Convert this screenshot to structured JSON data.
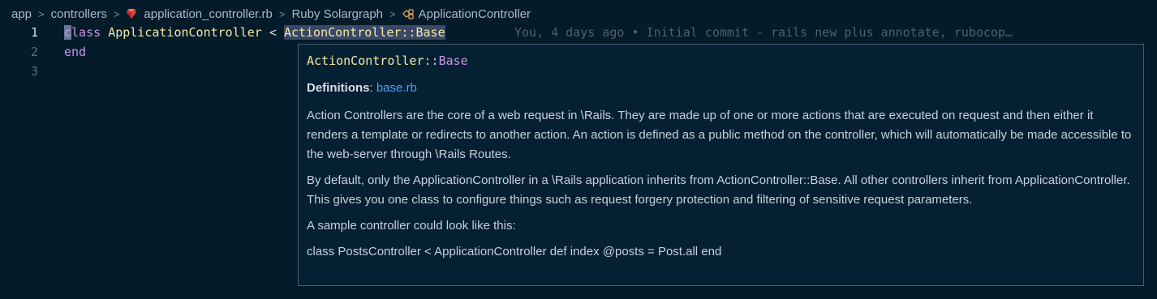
{
  "breadcrumb": {
    "items": [
      "app",
      "controllers",
      "application_controller.rb",
      "Ruby Solargraph",
      "ApplicationController"
    ],
    "separator": ">"
  },
  "editor": {
    "line_numbers": [
      "1",
      "2",
      "3"
    ],
    "line1": {
      "kw_c": "c",
      "kw_rest": "lass",
      "class_name": "ApplicationController",
      "op": "<",
      "parent": "ActionController::Base"
    },
    "line2": {
      "kw": "end"
    },
    "blame": "You, 4 days ago • Initial commit - rails new plus annotate, rubocop…"
  },
  "hover": {
    "signature": {
      "cls": "ActionController",
      "sep": "::",
      "base": "Base"
    },
    "definitions_label": "Definitions",
    "definitions_colon": ":",
    "definitions_link": "base.rb",
    "paragraphs": [
      "Action Controllers are the core of a web request in \\Rails. They are made up of one or more actions that are executed on request and then either it renders a template or redirects to another action. An action is defined as a public method on the controller, which will automatically be made accessible to the web-server through \\Rails Routes.",
      "By default, only the ApplicationController in a \\Rails application inherits from ActionController::Base. All other controllers inherit from ApplicationController. This gives you one class to configure things such as request forgery protection and filtering of sensitive request parameters.",
      "A sample controller could look like this:",
      "class PostsController < ApplicationController def index @posts = Post.all end"
    ]
  },
  "colors": {
    "background": "#041b2a",
    "keyword": "#c594e8",
    "class": "#f2e9a4",
    "link": "#4fa3f7"
  }
}
